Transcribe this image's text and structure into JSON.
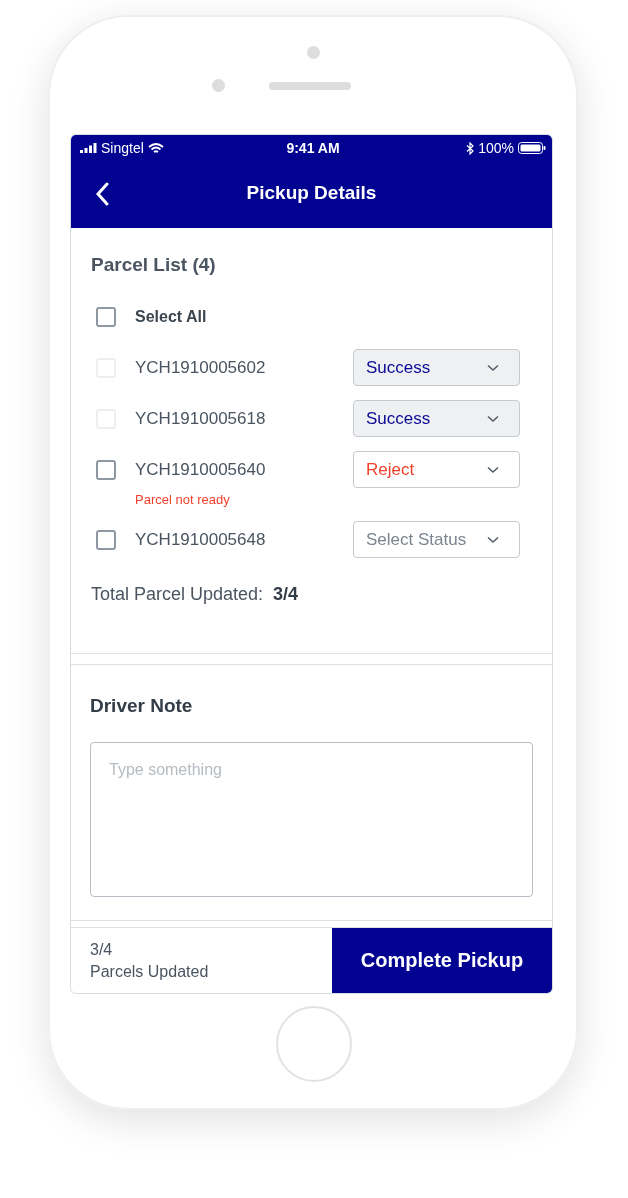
{
  "status_bar": {
    "carrier": "Singtel",
    "time": "9:41 AM",
    "battery": "100%"
  },
  "nav": {
    "title": "Pickup Details"
  },
  "parcel_list": {
    "title": "Parcel List (4)",
    "select_all": {
      "label": "Select All",
      "checked": false
    },
    "parcels": [
      {
        "id": "YCH1910005602",
        "checked": false,
        "disabled": true,
        "status": {
          "kind": "success",
          "value": "Success",
          "disabled": true
        }
      },
      {
        "id": "YCH1910005618",
        "checked": false,
        "disabled": true,
        "status": {
          "kind": "success",
          "value": "Success",
          "disabled": true
        }
      },
      {
        "id": "YCH1910005640",
        "checked": false,
        "disabled": false,
        "status": {
          "kind": "reject",
          "value": "Reject",
          "disabled": false
        },
        "error": "Parcel not ready"
      },
      {
        "id": "YCH1910005648",
        "checked": false,
        "disabled": false,
        "status": {
          "kind": "empty",
          "placeholder": "Select Status",
          "disabled": false
        }
      }
    ],
    "total_label": "Total Parcel Updated:",
    "total_value": "3/4"
  },
  "driver_note": {
    "title": "Driver Note",
    "placeholder": "Type something"
  },
  "footer": {
    "count": "3/4",
    "count_label": "Parcels Updated",
    "button": "Complete Pickup"
  }
}
